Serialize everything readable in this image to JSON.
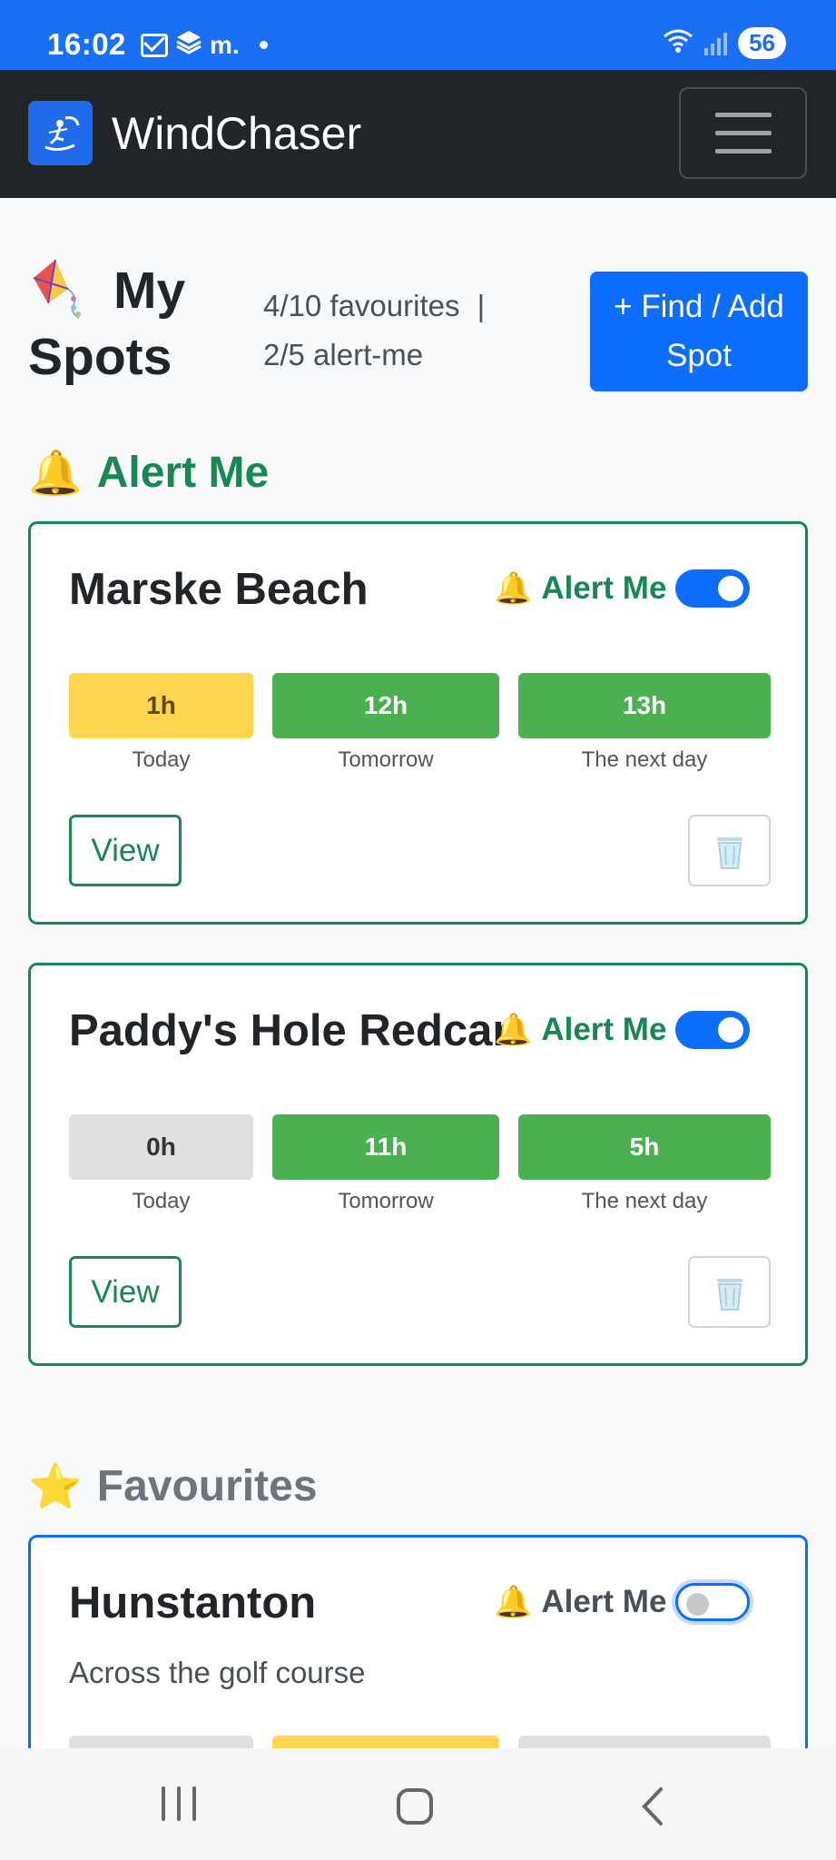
{
  "status_bar": {
    "time": "16:02",
    "carrier": "m.",
    "battery": "56",
    "icons": [
      "mail-icon",
      "layers-icon",
      "wifi-icon",
      "signal-icon"
    ]
  },
  "navbar": {
    "brand": "WindChaser",
    "logo_icon": "kitesurfer-icon",
    "menu_icon": "hamburger-menu-icon"
  },
  "header": {
    "title": "My Spots",
    "title_icon": "kite-icon",
    "favourites_count": "4/10 favourites",
    "separator": "|",
    "alert_count": "2/5 alert-me",
    "find_button": "+ Find / Add Spot"
  },
  "sections": {
    "alert": {
      "emoji": "🔔",
      "title": "Alert Me"
    },
    "favourites": {
      "emoji": "⭐",
      "title": "Favourites"
    }
  },
  "spots": [
    {
      "name": "Marske Beach",
      "alert_bell": "🔔",
      "alert_label": "Alert Me",
      "alert_on": true,
      "forecast": [
        {
          "hours": "1h",
          "label": "Today",
          "status": "yellow"
        },
        {
          "hours": "12h",
          "label": "Tomorrow",
          "status": "green"
        },
        {
          "hours": "13h",
          "label": "The next day",
          "status": "green"
        }
      ],
      "view_label": "View",
      "delete_icon": "trash-icon"
    },
    {
      "name": "Paddy's Hole Redcar",
      "alert_bell": "🔔",
      "alert_label": "Alert Me",
      "alert_on": true,
      "forecast": [
        {
          "hours": "0h",
          "label": "Today",
          "status": "grey"
        },
        {
          "hours": "11h",
          "label": "Tomorrow",
          "status": "green"
        },
        {
          "hours": "5h",
          "label": "The next day",
          "status": "green"
        }
      ],
      "view_label": "View",
      "delete_icon": "trash-icon"
    },
    {
      "name": "Hunstanton",
      "alert_bell": "🔔",
      "alert_label": "Alert Me",
      "alert_on": false,
      "description": "Across the golf course",
      "forecast_status": [
        "grey",
        "yellow",
        "grey"
      ]
    }
  ],
  "colors": {
    "status_bar": "#1a6ff5",
    "navbar": "#212529",
    "primary": "#0d6efd",
    "success": "#198754",
    "forecast_yellow": "#ffd54f",
    "forecast_green": "#4caf50",
    "forecast_grey": "#e0e0e0"
  }
}
